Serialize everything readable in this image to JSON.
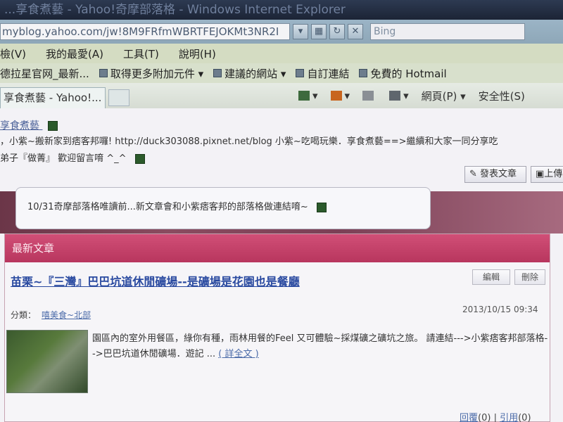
{
  "window": {
    "title": "...享食煮藝 - Yahoo!奇摩部落格 - Windows Internet Explorer"
  },
  "addressbar": {
    "url": "myblog.yahoo.com/jw!8M9FRfmWBRTFEJOKMt3NR2I",
    "search_placeholder": "Bing"
  },
  "menubar": {
    "items": [
      "檢(V)",
      "我的最愛(A)",
      "工具(T)",
      "說明(H)"
    ]
  },
  "favorites": {
    "items": [
      "德拉星官网_最新...",
      "取得更多附加元件 ▾",
      "建議的網站 ▾",
      "自訂連結",
      "免費的 Hotmail"
    ]
  },
  "commandbar": {
    "tab_label": "享食煮藝 - Yahoo!...",
    "page_menu": "網頁(P) ▾",
    "safety_menu": "安全性(S)"
  },
  "blog": {
    "title": "享食煮藝",
    "desc_line1": "，小紫~搬新家到痞客邦囉! http://duck303088.pixnet.net/blog 小紫~吃喝玩樂．享食煮藝==>繼續和大家一同分享吃",
    "desc_line2": "弟子『做菁』 歡迎留言唷 ^_^",
    "post_button": "發表文章",
    "upload_button": "上傳",
    "notice": "10/31奇摩部落格唯讀前...新文章會和小紫痞客邦的部落格做連結唷~"
  },
  "latest": {
    "header": "最新文章",
    "article_title": "苗栗~『三灣』巴巴坑道休閒礦場--是礦場是花園也是餐廳",
    "edit_button": "編輯",
    "delete_button": "刪除",
    "category_label": "分類：",
    "category_value": "嘻美食~北部",
    "date": "2013/10/15 09:34",
    "excerpt": "園區內的室外用餐區，綠你有種，雨林用餐的Feel 又可體驗~採煤礦之礦坑之旅。 請連結--->小紫痞客邦部落格-->巴巴坑道休閒礦場．遊記 ... ",
    "read_more": "( 詳全文 )",
    "reply_label": "回覆",
    "reply_count": "(0)",
    "ref_label": "引用",
    "ref_count": "(0)"
  }
}
